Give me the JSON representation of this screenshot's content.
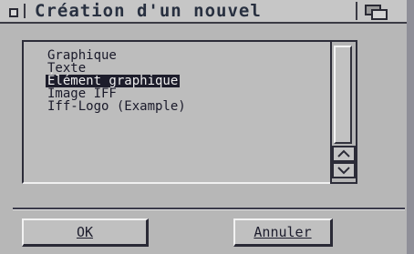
{
  "window": {
    "title": "Création d'un nouvel"
  },
  "list": {
    "items": [
      {
        "label": "Graphique",
        "selected": false
      },
      {
        "label": "Texte",
        "selected": false
      },
      {
        "label": "Élément graphique",
        "selected": true
      },
      {
        "label": "Image IFF",
        "selected": false
      },
      {
        "label": "Iff-Logo (Example)",
        "selected": false
      }
    ]
  },
  "buttons": {
    "ok_label": "OK",
    "cancel_label": "Annuler"
  },
  "icons": {
    "close": "close-gadget-icon",
    "depth": "depth-gadget-icon",
    "scroll_up": "arrow-up-icon",
    "scroll_down": "arrow-down-icon"
  },
  "colors": {
    "window_bg": "#b7b7b7",
    "selection_bg": "#1d1d2b",
    "selection_fg": "#efefef",
    "text": "#1a1a2a"
  }
}
